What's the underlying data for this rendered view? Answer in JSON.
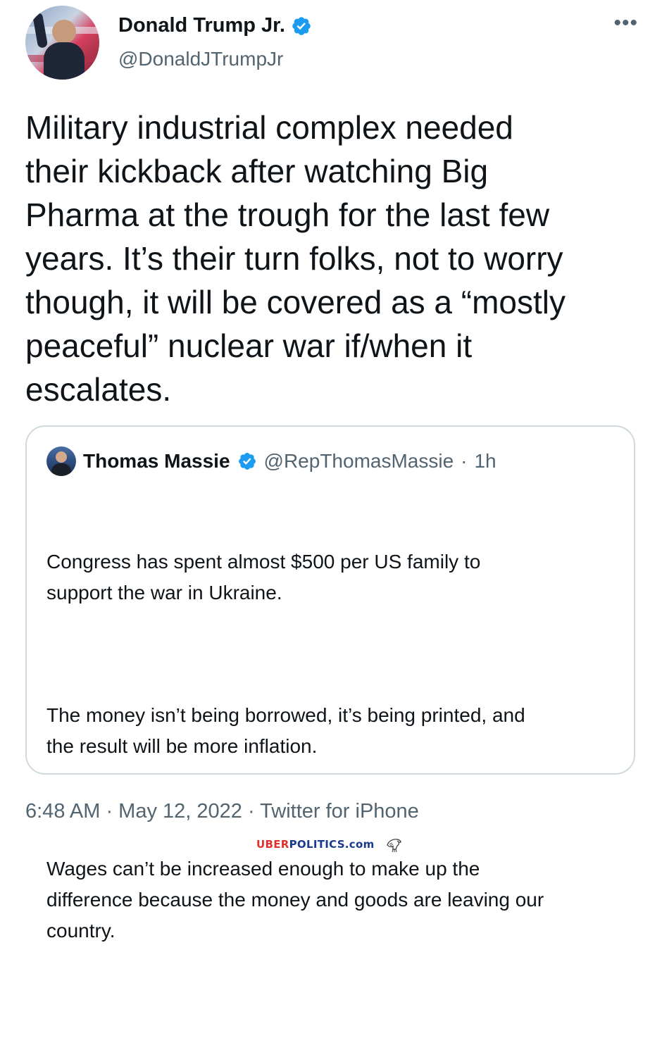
{
  "tweet": {
    "author": {
      "display_name": "Donald Trump Jr.",
      "handle": "@DonaldJTrumpJr",
      "verified_icon": "verified-badge-icon"
    },
    "more_icon": "more-options-icon",
    "text": "Military industrial complex needed\ntheir kickback after watching Big\nPharma at the trough for the last few\nyears. It’s their turn folks, not to worry\nthough, it will be covered as a “mostly\npeaceful” nuclear war if/when it\nescalates.",
    "quoted": {
      "display_name": "Thomas Massie",
      "handle": "@RepThomasMassie",
      "separator": "·",
      "time": "1h",
      "paragraphs": [
        "Congress has spent almost $500 per US family to\nsupport the war in Ukraine.",
        "The money isn’t being borrowed, it’s being printed, and\nthe result will be more inflation.",
        "Wages can’t be increased enough to make up the\ndifference because the money and goods are leaving our\ncountry."
      ]
    },
    "footer": "6:48 AM · May 12, 2022 · Twitter for iPhone"
  },
  "watermark": {
    "part1": "UBER",
    "part2": "POLITICS.com",
    "icon": "eagle-icon"
  },
  "colors": {
    "verified": "#1d9bf0",
    "text": "#0f1419",
    "secondary": "#536471",
    "border": "#cfd9de",
    "watermark_red": "#e0322c",
    "watermark_blue": "#1a3a8f"
  }
}
